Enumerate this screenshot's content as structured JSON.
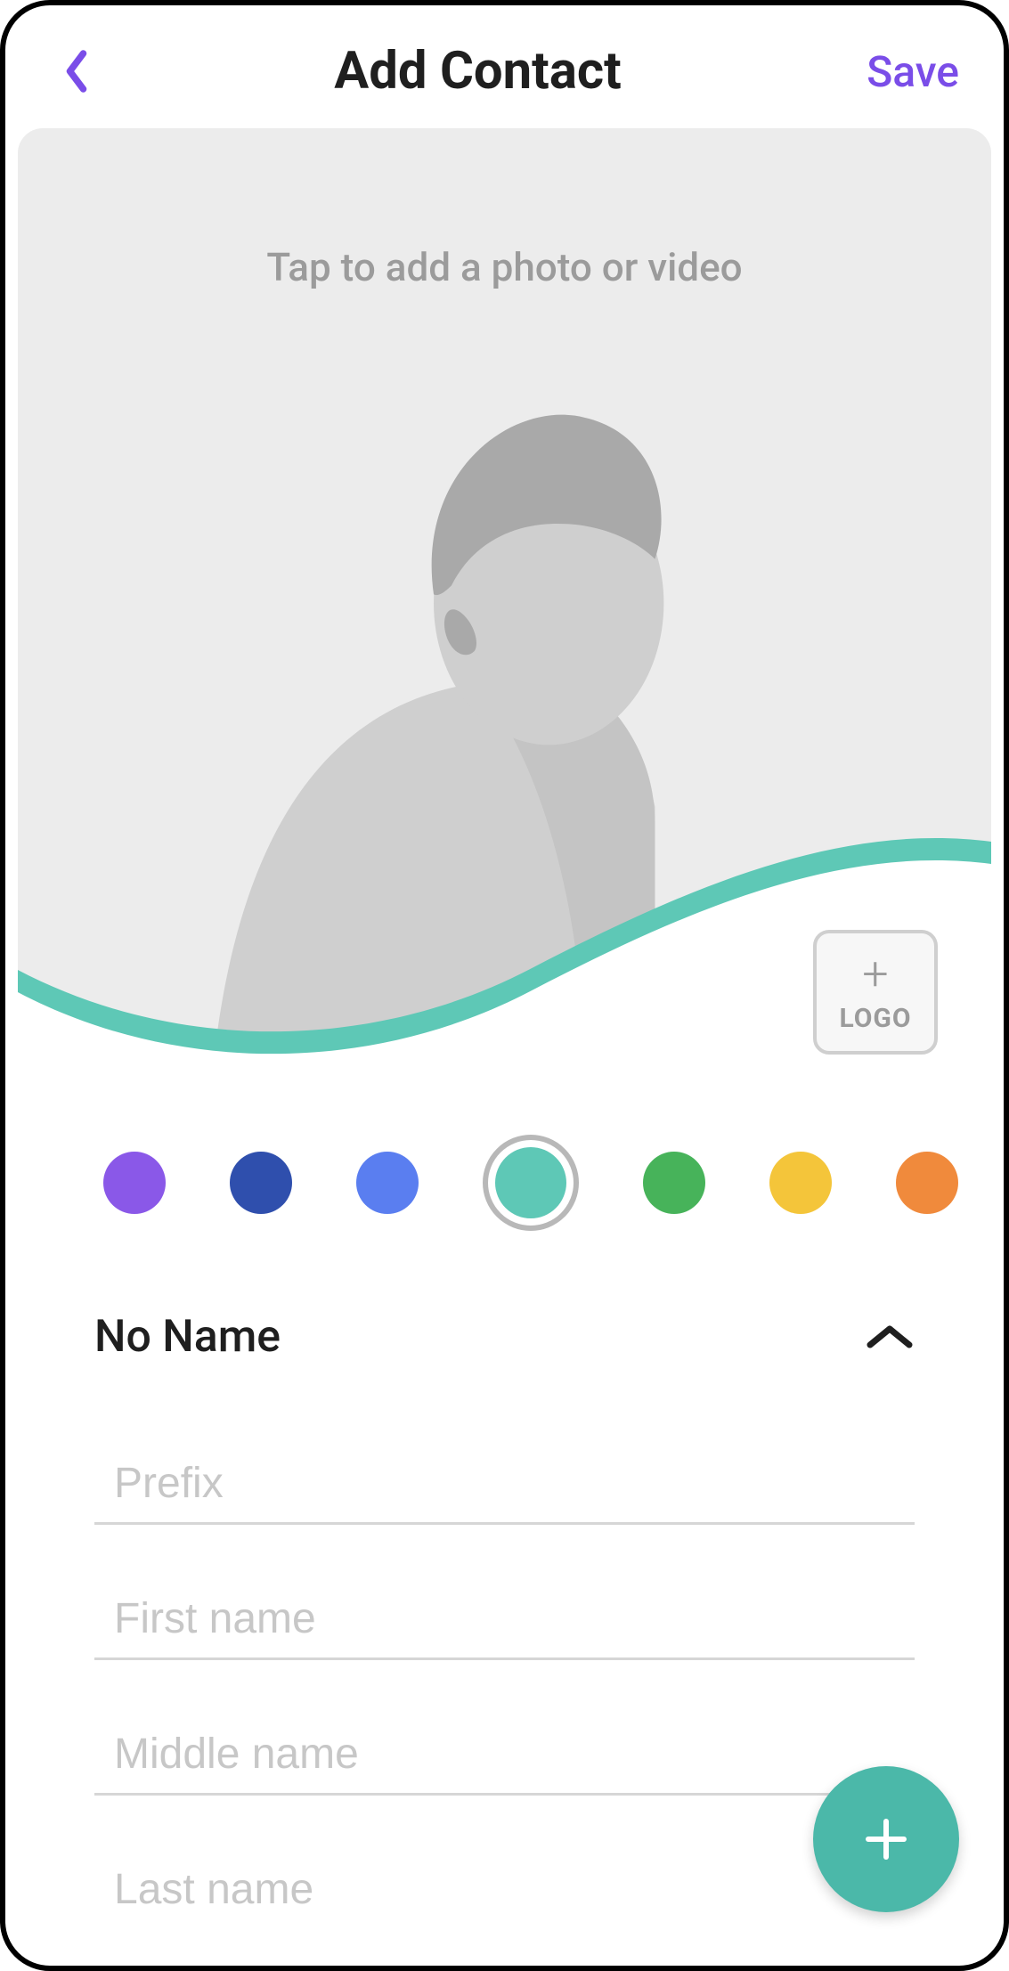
{
  "header": {
    "title": "Add Contact",
    "save_label": "Save"
  },
  "photo": {
    "prompt": "Tap to add a photo or video",
    "logo_label": "LOGO"
  },
  "colors": {
    "options": [
      "#8a58e8",
      "#2f4fad",
      "#5a7ef0",
      "#5ec8b6",
      "#47b35a",
      "#f4c53a",
      "#f08a3c",
      "#e94a3a"
    ],
    "selected_index": 3
  },
  "name": {
    "toggle_label": "No Name",
    "expanded": true,
    "fields": [
      {
        "placeholder": "Prefix",
        "value": ""
      },
      {
        "placeholder": "First name",
        "value": ""
      },
      {
        "placeholder": "Middle name",
        "value": ""
      },
      {
        "placeholder": "Last name",
        "value": ""
      }
    ]
  },
  "accent_color": "#5ec8b6",
  "primary_action_color": "#7a4de8"
}
